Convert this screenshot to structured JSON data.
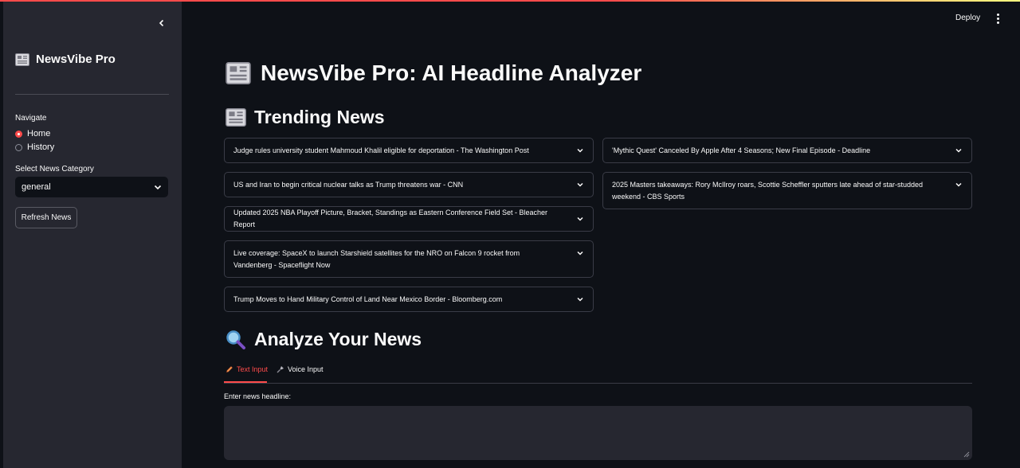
{
  "sidebar": {
    "brand": "NewsVibe Pro",
    "brand_icon": "newspaper-icon",
    "navigate_label": "Navigate",
    "nav_options": [
      {
        "label": "Home",
        "selected": true
      },
      {
        "label": "History",
        "selected": false
      }
    ],
    "category_label": "Select News Category",
    "category_value": "general",
    "refresh_label": "Refresh News"
  },
  "header": {
    "deploy_label": "Deploy"
  },
  "main": {
    "title": "NewsVibe Pro: AI Headline Analyzer",
    "trending_heading": "Trending News",
    "analyze_heading": "Analyze Your News",
    "headlines_left": [
      "Judge rules university student Mahmoud Khalil eligible for deportation - The Washington Post",
      "US and Iran to begin critical nuclear talks as Trump threatens war - CNN",
      "Updated 2025 NBA Playoff Picture, Bracket, Standings as Eastern Conference Field Set - Bleacher Report",
      "Live coverage: SpaceX to launch Starshield satellites for the NRO on Falcon 9 rocket from Vandenberg - Spaceflight Now",
      "Trump Moves to Hand Military Control of Land Near Mexico Border - Bloomberg.com"
    ],
    "headlines_right": [
      "'Mythic Quest' Canceled By Apple After 4 Seasons; New Final Episode - Deadline",
      "2025 Masters takeaways: Rory McIlroy roars, Scottie Scheffler sputters late ahead of star-studded weekend - CBS Sports"
    ],
    "tabs": [
      {
        "label": "Text Input",
        "icon": "pencil-icon",
        "active": true
      },
      {
        "label": "Voice Input",
        "icon": "microphone-icon",
        "active": false
      }
    ],
    "input_label": "Enter news headline:",
    "input_value": ""
  },
  "colors": {
    "accent": "#ff4b4b",
    "background": "#0e1117",
    "sidebar": "#262730"
  }
}
